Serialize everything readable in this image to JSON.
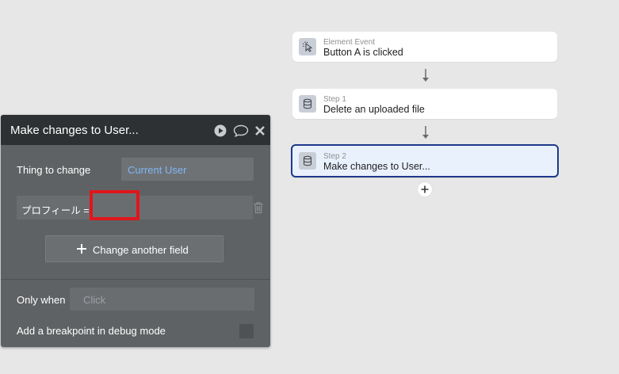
{
  "workflow": {
    "event": {
      "sub": "Element Event",
      "main": "Button A is clicked",
      "icon": "cursor-click-icon"
    },
    "steps": [
      {
        "sub": "Step 1",
        "main": "Delete an uploaded file",
        "icon": "database-icon"
      },
      {
        "sub": "Step 2",
        "main": "Make changes to User...",
        "icon": "database-icon",
        "active": true
      }
    ],
    "add_step_icon": "plus-icon"
  },
  "panel": {
    "title": "Make changes to User...",
    "header_icons": [
      "play-icon",
      "comment-icon",
      "close-icon"
    ],
    "thing_to_change_label": "Thing to change",
    "thing_to_change_value": "Current User",
    "field_name": "プロフィール  =",
    "field_value": "",
    "change_another_field_label": "Change another field",
    "only_when_label": "Only when",
    "only_when_placeholder": "Click",
    "breakpoint_label": "Add a breakpoint in debug mode",
    "breakpoint_checked": false
  },
  "colors": {
    "background": "#e7e7e7",
    "panel": "#5f6264",
    "panel_header": "#2e3133",
    "link_value": "#7fb6f5",
    "active_border": "#1d3a8a",
    "highlight": "#e0161b"
  }
}
